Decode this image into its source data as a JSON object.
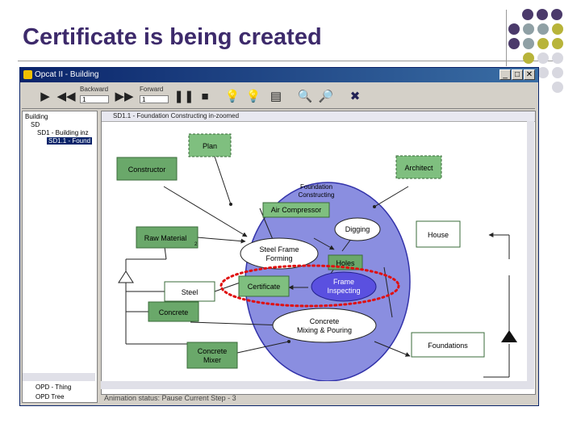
{
  "slide": {
    "title": "Certificate is being created",
    "colors": {
      "title": "#3d2a6b",
      "dot_purple": "#4b3a6b",
      "dot_gray": "#8fa0a5",
      "dot_olive": "#b8b43a",
      "dot_light": "#d8d8e0"
    }
  },
  "window": {
    "title": "Opcat II - Building",
    "buttons": {
      "minimize": "_",
      "maximize": "□",
      "close": "✕"
    }
  },
  "toolbar": {
    "backward_label": "Backward",
    "backward_value": "1",
    "forward_label": "Forward",
    "forward_value": "1",
    "icons": [
      "play-icon",
      "step-back-icon",
      "step-forward-icon",
      "pause-icon",
      "stop-icon",
      "bulb-on-icon",
      "bulb-off-icon",
      "document-icon",
      "zoom-in-icon",
      "zoom-out-icon",
      "settings-cross-icon"
    ]
  },
  "tree": {
    "items": [
      "Building",
      "SD",
      "SD1 - Building inz",
      "SD1.1 - Found"
    ],
    "tabs": [
      "OPD - Thing",
      "OPD Tree"
    ]
  },
  "diagram": {
    "tab_title": "SD1.1 - Foundation Constructing in-zoomed",
    "status": "Animation status: Pause  Current Step - 3",
    "nodes": {
      "plan": "Plan",
      "constructor": "Constructor",
      "architect": "Architect",
      "foundation_1": "Foundation",
      "foundation_2": "Constructing",
      "air_compressor": "Air Compressor",
      "digging": "Digging",
      "raw_material": "Raw Material",
      "raw_material_sub": "2",
      "steel_frame_1": "Steel Frame",
      "steel_frame_2": "Forming",
      "holes": "Holes",
      "house": "House",
      "steel": "Steel",
      "certificate": "Certificate",
      "frame_insp_1": "Frame",
      "frame_insp_2": "Inspecting",
      "concrete": "Concrete",
      "cmix_1": "Concrete",
      "cmix_2": "Mixing & Pouring",
      "foundations": "Foundations",
      "mixer_1": "Concrete",
      "mixer_2": "Mixer"
    }
  }
}
